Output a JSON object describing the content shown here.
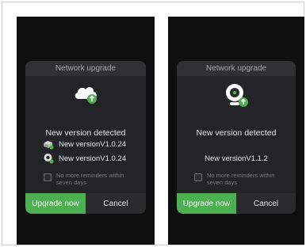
{
  "left_panel": {
    "header": "Network upgrade",
    "title": "New version detected",
    "versions": [
      "New versionV1.0.24",
      "New versionV1.0.24"
    ],
    "reminder": "No more reminders within seven days",
    "primary_button": "Upgrade now",
    "secondary_button": "Cancel"
  },
  "right_panel": {
    "header": "Network upgrade",
    "title": "New version detected",
    "version": "New versionV1.1.2",
    "reminder": "No more reminders within seven days",
    "primary_button": "Upgrade now",
    "secondary_button": "Cancel"
  },
  "colors": {
    "accent": "#4caf50",
    "screen_bg": "#0f0f10",
    "dialog_bg": "#232425"
  },
  "icons": {
    "left_hero": "cloud-upgrade-icon",
    "right_hero": "camera-upgrade-icon",
    "device_a": "router-icon",
    "device_b": "camera-icon"
  }
}
